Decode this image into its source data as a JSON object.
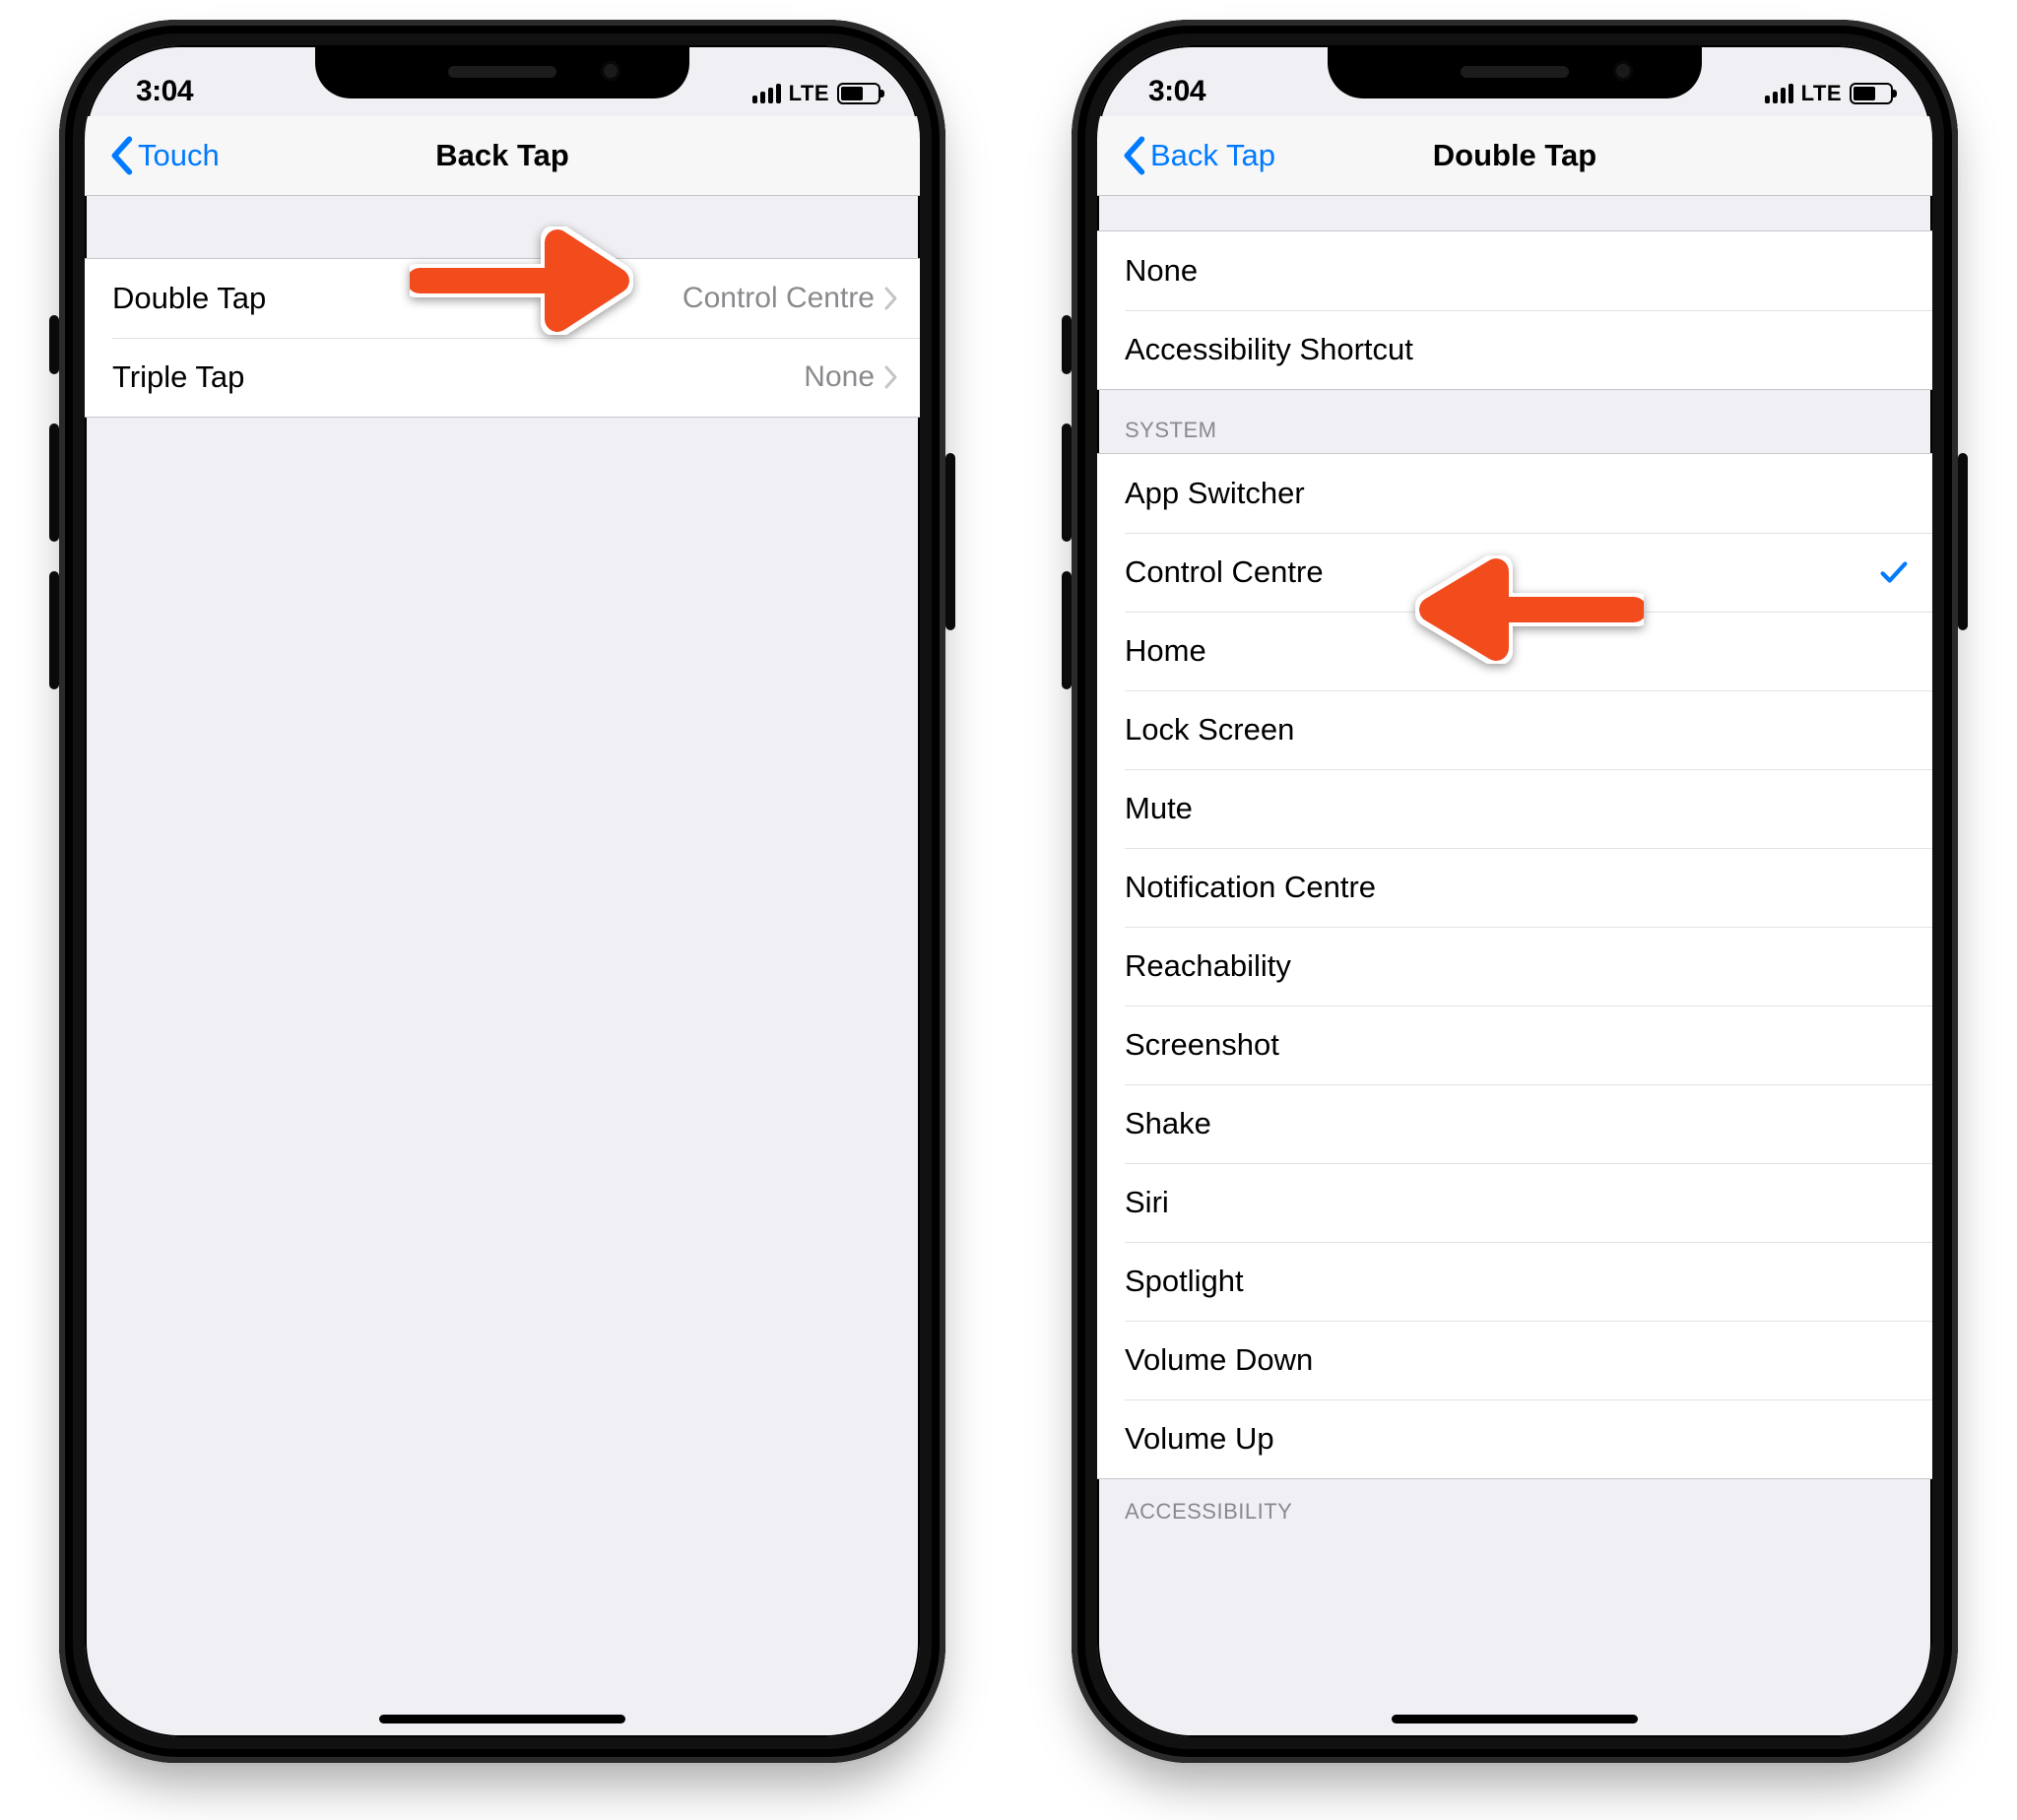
{
  "status": {
    "time": "3:04",
    "network": "LTE"
  },
  "left_phone": {
    "back_label": "Touch",
    "title": "Back Tap",
    "rows": [
      {
        "label": "Double Tap",
        "value": "Control Centre"
      },
      {
        "label": "Triple Tap",
        "value": "None"
      }
    ]
  },
  "right_phone": {
    "back_label": "Back Tap",
    "title": "Double Tap",
    "top_rows": [
      {
        "label": "None"
      },
      {
        "label": "Accessibility Shortcut"
      }
    ],
    "system_header": "System",
    "system_rows": [
      {
        "label": "App Switcher",
        "checked": false
      },
      {
        "label": "Control Centre",
        "checked": true
      },
      {
        "label": "Home",
        "checked": false
      },
      {
        "label": "Lock Screen",
        "checked": false
      },
      {
        "label": "Mute",
        "checked": false
      },
      {
        "label": "Notification Centre",
        "checked": false
      },
      {
        "label": "Reachability",
        "checked": false
      },
      {
        "label": "Screenshot",
        "checked": false
      },
      {
        "label": "Shake",
        "checked": false
      },
      {
        "label": "Siri",
        "checked": false
      },
      {
        "label": "Spotlight",
        "checked": false
      },
      {
        "label": "Volume Down",
        "checked": false
      },
      {
        "label": "Volume Up",
        "checked": false
      }
    ],
    "accessibility_header": "Accessibility"
  }
}
